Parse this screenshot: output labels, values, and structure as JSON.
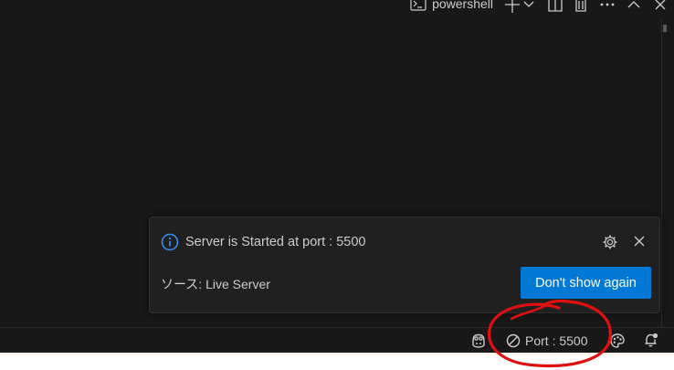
{
  "terminal": {
    "name": "powershell",
    "toolbar_icons": [
      "terminal-icon",
      "add-icon",
      "chevron-down-icon",
      "split-icon",
      "trash-icon",
      "more-icon",
      "chevron-up-icon",
      "close-icon"
    ]
  },
  "notification": {
    "message": "Server is Started at port : 5500",
    "source": "ソース: Live Server",
    "button_label": "Don't show again",
    "icons": [
      "info-icon",
      "gear-icon",
      "close-icon"
    ]
  },
  "status_bar": {
    "port_label": "Port : 5500",
    "icons": [
      "copilot-icon",
      "prohibit-icon",
      "palette-icon",
      "bell-dot-icon"
    ]
  },
  "colors": {
    "panel_bg": "#181818",
    "toast_bg": "#202020",
    "accent": "#0078d4",
    "info_blue": "#3794ff",
    "annotation_red": "#e01010"
  }
}
